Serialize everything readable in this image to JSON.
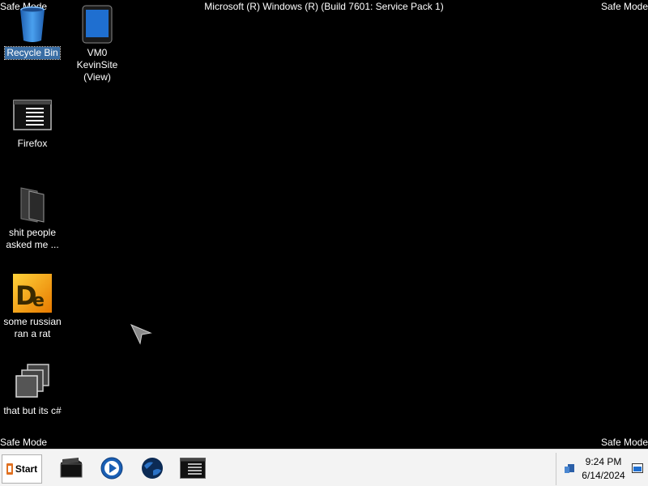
{
  "overlay": {
    "safe_mode": "Safe Mode",
    "build": "Microsoft (R) Windows (R) (Build 7601: Service Pack 1)"
  },
  "desktop": {
    "icons": [
      {
        "name": "recycle-bin",
        "label": "Recycle Bin",
        "icon": "recycle-bin-icon",
        "selected": true
      },
      {
        "name": "vm0-kevinsite",
        "label_line1": "VM0 KevinSite",
        "label_line2": "(View)",
        "icon": "tablet-icon"
      },
      {
        "name": "firefox",
        "label": "Firefox",
        "icon": "console-window-icon"
      },
      {
        "name": "folder-shit-people",
        "label_line1": "shit people",
        "label_line2": "asked me ...",
        "icon": "folder-icon"
      },
      {
        "name": "some-russian-ran-a-rat",
        "label_line1": "some russian",
        "label_line2": "ran a rat",
        "icon": "de-app-icon"
      },
      {
        "name": "that-but-its-csharp",
        "label": "that but its c#",
        "icon": "stacked-windows-icon"
      }
    ]
  },
  "taskbar": {
    "start_label": "Start",
    "pinned": [
      {
        "name": "file-explorer",
        "icon": "folder-dark-icon"
      },
      {
        "name": "media-player",
        "icon": "play-icon"
      },
      {
        "name": "browser",
        "icon": "globe-icon"
      },
      {
        "name": "console",
        "icon": "console-window-icon"
      }
    ],
    "clock_time": "9:24 PM",
    "clock_date": "6/14/2024"
  },
  "colors": {
    "desktop": "#000000",
    "taskbar": "#f3f3f3",
    "selection": "#3a6ea5",
    "recycle_blue": "#2f7fd4"
  }
}
